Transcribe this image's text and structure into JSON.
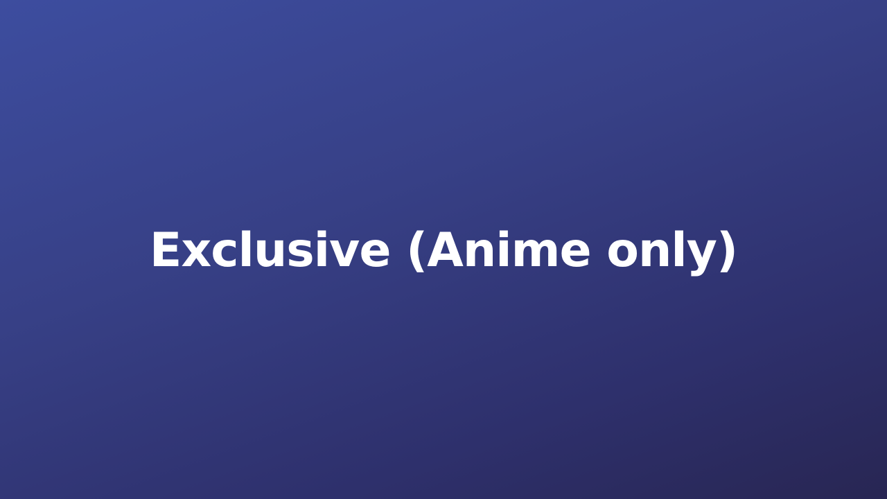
{
  "title": "Exclusive (Anime only)",
  "colors": {
    "background_top_left": "#3d4d9f",
    "background_bottom_right": "#282653",
    "text": "#ffffff"
  }
}
